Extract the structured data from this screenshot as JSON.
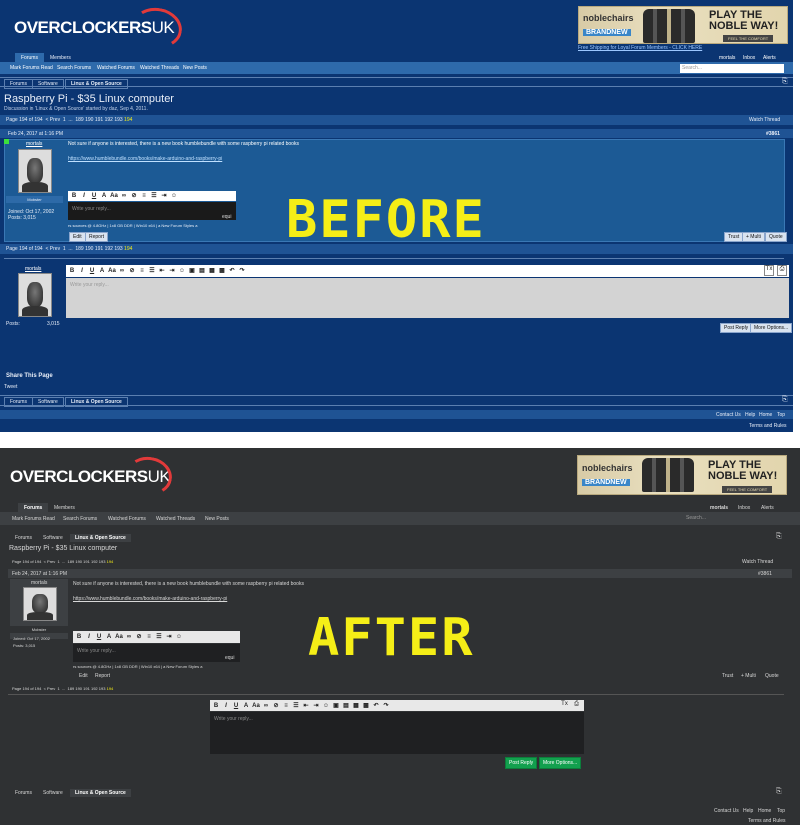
{
  "site": {
    "logo_main": "OVERCLOCKERS",
    "logo_suffix": "UK"
  },
  "banner": {
    "brand": "noblechairs",
    "line1": "PLAY THE",
    "line2": "NOBLE WAY!",
    "tag": "BRANDNEW",
    "cta": "FEEL THE COMFORT",
    "promo_link": "Free Shipping for Loyal Forum Members - CLICK HERE"
  },
  "nav": {
    "tabs": [
      "Forums",
      "Members"
    ],
    "sublinks": [
      "Mark Forums Read",
      "Search Forums",
      "Watched Forums",
      "Watched Threads",
      "New Posts"
    ],
    "search_placeholder": "Search...",
    "user_links": [
      "mortals",
      "Inbox",
      "Alerts"
    ]
  },
  "breadcrumb": [
    "Forums",
    "Software",
    "Linux & Open Source"
  ],
  "thread": {
    "title": "Raspberry Pi - $35 Linux computer",
    "meta": "Discussion in 'Linux & Open Source' started by daz, Sep 4, 2011.",
    "watch": "Watch Thread"
  },
  "pagination": {
    "label": "Page 194 of 194",
    "prev": "< Prev",
    "first": "1",
    "ellipsis": "...",
    "pages": [
      "189",
      "190",
      "191",
      "192",
      "193"
    ],
    "current": "194"
  },
  "post": {
    "date": "Feb 24, 2017 at 1:16 PM",
    "number": "#3861",
    "author": "mortals",
    "role": "Mobster",
    "joined_label": "Joined:",
    "joined": "Oct 17, 2002",
    "posts_label": "Posts:",
    "posts": "3,015",
    "text": "Not sure if anyone is interested, there is a new book humblebundle with some raspberry pi related books",
    "link": "https://www.humblebundle.com/books/make-arduino-and-raspberry-pi",
    "editor_placeholder": "Write your reply...",
    "editor_word": "equi",
    "sig": "rs sources @ 4.8GHz | 1x8 GB DDR | Win10 x64 | a New Forum Styles a",
    "actions": [
      "Edit",
      "Report"
    ],
    "right_actions": [
      "Trust",
      "+ Multi",
      "Quote"
    ]
  },
  "reply": {
    "author": "mortals",
    "posts_label": "Posts:",
    "posts": "3,015",
    "placeholder": "Write your reply...",
    "post_btn": "Post Reply",
    "more_btn": "More Options..."
  },
  "share": {
    "title": "Share This Page",
    "tweet": "Tweet"
  },
  "footer": {
    "links": [
      "Contact Us",
      "Help",
      "Home",
      "Top"
    ],
    "terms": "Terms and Rules"
  },
  "labels": {
    "before": "BEFORE",
    "after": "AFTER"
  },
  "colors": {
    "before_bg": "#0b3572",
    "after_bg": "#2f3133",
    "accent_yellow": "#f5ee17",
    "green_button": "#12a04e"
  }
}
